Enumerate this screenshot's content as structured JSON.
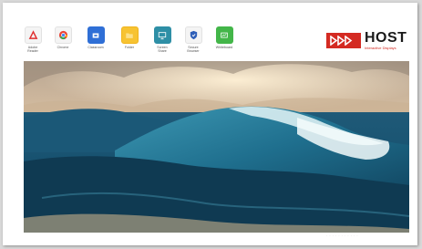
{
  "apps": [
    {
      "icon": "pdf-icon",
      "label": "Adobe\nReader",
      "color": "#e02f2f"
    },
    {
      "icon": "chrome-icon",
      "label": "Chrome",
      "color": "#4285f4"
    },
    {
      "icon": "classroom-icon",
      "label": "Classroom",
      "color": "#2f6fd6"
    },
    {
      "icon": "folder-icon",
      "label": "Folder",
      "color": "#f3b81f"
    },
    {
      "icon": "screen-share-icon",
      "label": "Screen\nShare",
      "color": "#2e8fa6"
    },
    {
      "icon": "shield-icon",
      "label": "Secure\nBrowser",
      "color": "#2f5fb8"
    },
    {
      "icon": "whiteboard-icon",
      "label": "Whiteboard",
      "color": "#43b649"
    }
  ],
  "logo": {
    "word": "HOST",
    "tagline": "Interactive Displays",
    "brand_color": "#d42a22"
  },
  "caption": "· · · · · · · · · · ·"
}
